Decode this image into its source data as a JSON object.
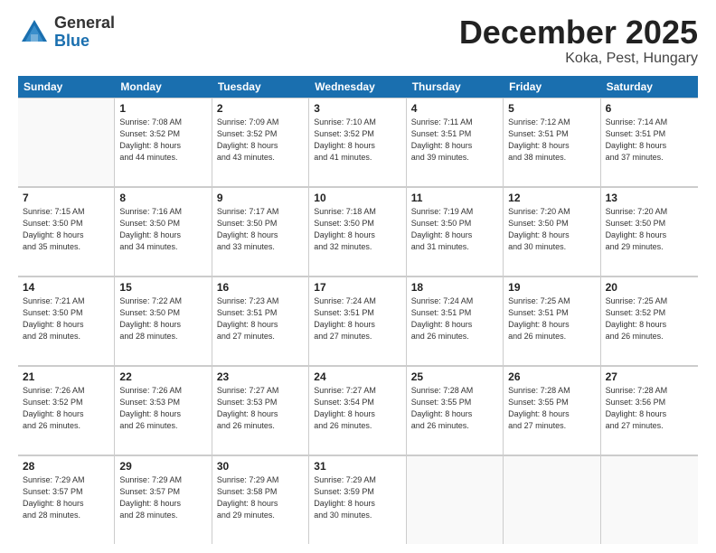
{
  "logo": {
    "general": "General",
    "blue": "Blue"
  },
  "title": "December 2025",
  "location": "Koka, Pest, Hungary",
  "days": [
    "Sunday",
    "Monday",
    "Tuesday",
    "Wednesday",
    "Thursday",
    "Friday",
    "Saturday"
  ],
  "weeks": [
    [
      {
        "day": "",
        "content": ""
      },
      {
        "day": "1",
        "content": "Sunrise: 7:08 AM\nSunset: 3:52 PM\nDaylight: 8 hours\nand 44 minutes."
      },
      {
        "day": "2",
        "content": "Sunrise: 7:09 AM\nSunset: 3:52 PM\nDaylight: 8 hours\nand 43 minutes."
      },
      {
        "day": "3",
        "content": "Sunrise: 7:10 AM\nSunset: 3:52 PM\nDaylight: 8 hours\nand 41 minutes."
      },
      {
        "day": "4",
        "content": "Sunrise: 7:11 AM\nSunset: 3:51 PM\nDaylight: 8 hours\nand 39 minutes."
      },
      {
        "day": "5",
        "content": "Sunrise: 7:12 AM\nSunset: 3:51 PM\nDaylight: 8 hours\nand 38 minutes."
      },
      {
        "day": "6",
        "content": "Sunrise: 7:14 AM\nSunset: 3:51 PM\nDaylight: 8 hours\nand 37 minutes."
      }
    ],
    [
      {
        "day": "7",
        "content": "Sunrise: 7:15 AM\nSunset: 3:50 PM\nDaylight: 8 hours\nand 35 minutes."
      },
      {
        "day": "8",
        "content": "Sunrise: 7:16 AM\nSunset: 3:50 PM\nDaylight: 8 hours\nand 34 minutes."
      },
      {
        "day": "9",
        "content": "Sunrise: 7:17 AM\nSunset: 3:50 PM\nDaylight: 8 hours\nand 33 minutes."
      },
      {
        "day": "10",
        "content": "Sunrise: 7:18 AM\nSunset: 3:50 PM\nDaylight: 8 hours\nand 32 minutes."
      },
      {
        "day": "11",
        "content": "Sunrise: 7:19 AM\nSunset: 3:50 PM\nDaylight: 8 hours\nand 31 minutes."
      },
      {
        "day": "12",
        "content": "Sunrise: 7:20 AM\nSunset: 3:50 PM\nDaylight: 8 hours\nand 30 minutes."
      },
      {
        "day": "13",
        "content": "Sunrise: 7:20 AM\nSunset: 3:50 PM\nDaylight: 8 hours\nand 29 minutes."
      }
    ],
    [
      {
        "day": "14",
        "content": "Sunrise: 7:21 AM\nSunset: 3:50 PM\nDaylight: 8 hours\nand 28 minutes."
      },
      {
        "day": "15",
        "content": "Sunrise: 7:22 AM\nSunset: 3:50 PM\nDaylight: 8 hours\nand 28 minutes."
      },
      {
        "day": "16",
        "content": "Sunrise: 7:23 AM\nSunset: 3:51 PM\nDaylight: 8 hours\nand 27 minutes."
      },
      {
        "day": "17",
        "content": "Sunrise: 7:24 AM\nSunset: 3:51 PM\nDaylight: 8 hours\nand 27 minutes."
      },
      {
        "day": "18",
        "content": "Sunrise: 7:24 AM\nSunset: 3:51 PM\nDaylight: 8 hours\nand 26 minutes."
      },
      {
        "day": "19",
        "content": "Sunrise: 7:25 AM\nSunset: 3:51 PM\nDaylight: 8 hours\nand 26 minutes."
      },
      {
        "day": "20",
        "content": "Sunrise: 7:25 AM\nSunset: 3:52 PM\nDaylight: 8 hours\nand 26 minutes."
      }
    ],
    [
      {
        "day": "21",
        "content": "Sunrise: 7:26 AM\nSunset: 3:52 PM\nDaylight: 8 hours\nand 26 minutes."
      },
      {
        "day": "22",
        "content": "Sunrise: 7:26 AM\nSunset: 3:53 PM\nDaylight: 8 hours\nand 26 minutes."
      },
      {
        "day": "23",
        "content": "Sunrise: 7:27 AM\nSunset: 3:53 PM\nDaylight: 8 hours\nand 26 minutes."
      },
      {
        "day": "24",
        "content": "Sunrise: 7:27 AM\nSunset: 3:54 PM\nDaylight: 8 hours\nand 26 minutes."
      },
      {
        "day": "25",
        "content": "Sunrise: 7:28 AM\nSunset: 3:55 PM\nDaylight: 8 hours\nand 26 minutes."
      },
      {
        "day": "26",
        "content": "Sunrise: 7:28 AM\nSunset: 3:55 PM\nDaylight: 8 hours\nand 27 minutes."
      },
      {
        "day": "27",
        "content": "Sunrise: 7:28 AM\nSunset: 3:56 PM\nDaylight: 8 hours\nand 27 minutes."
      }
    ],
    [
      {
        "day": "28",
        "content": "Sunrise: 7:29 AM\nSunset: 3:57 PM\nDaylight: 8 hours\nand 28 minutes."
      },
      {
        "day": "29",
        "content": "Sunrise: 7:29 AM\nSunset: 3:57 PM\nDaylight: 8 hours\nand 28 minutes."
      },
      {
        "day": "30",
        "content": "Sunrise: 7:29 AM\nSunset: 3:58 PM\nDaylight: 8 hours\nand 29 minutes."
      },
      {
        "day": "31",
        "content": "Sunrise: 7:29 AM\nSunset: 3:59 PM\nDaylight: 8 hours\nand 30 minutes."
      },
      {
        "day": "",
        "content": ""
      },
      {
        "day": "",
        "content": ""
      },
      {
        "day": "",
        "content": ""
      }
    ]
  ]
}
